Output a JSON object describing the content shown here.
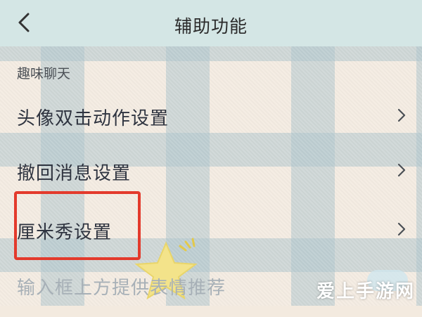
{
  "header": {
    "title": "辅助功能",
    "back_icon": "chevron-left-icon"
  },
  "section": {
    "title": "趣味聊天"
  },
  "rows": [
    {
      "label": "头像双击动作设置",
      "icon": "chevron-right-icon"
    },
    {
      "label": "撤回消息设置",
      "icon": "chevron-right-icon"
    },
    {
      "label": "厘米秀设置",
      "icon": "chevron-right-icon"
    },
    {
      "label": "输入框上方提供表情推荐",
      "icon": "toggle-switch"
    }
  ],
  "annotation": {
    "highlight_color": "#e33a2c"
  },
  "watermark": {
    "text": "爱上手游网"
  },
  "colors": {
    "topbar": "#d4e6e5",
    "plaid": "#b0c6cd",
    "text": "#2f3440"
  }
}
